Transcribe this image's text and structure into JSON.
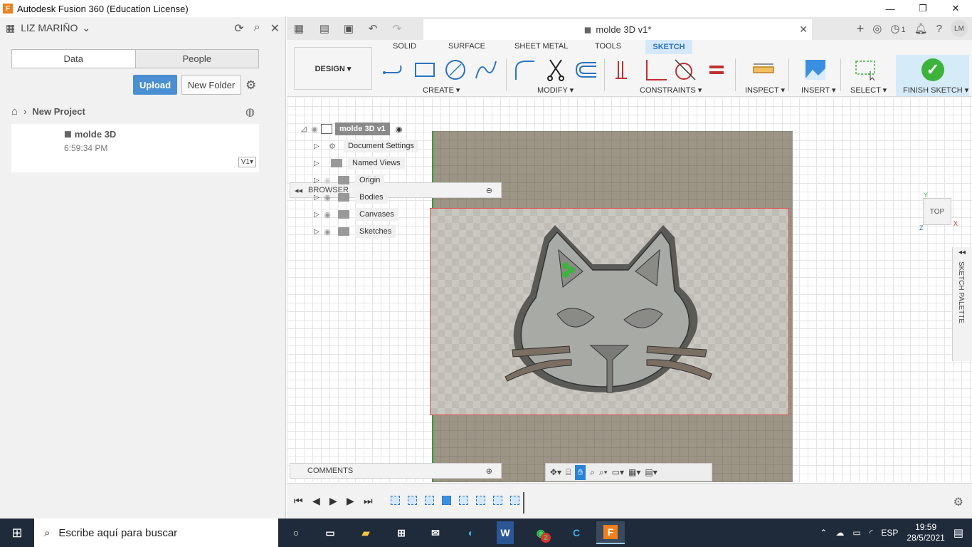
{
  "window": {
    "title": "Autodesk Fusion 360 (Education License)",
    "app_icon": "F",
    "min": "—",
    "restore": "❐",
    "close": "✕"
  },
  "left_panel": {
    "user": "LIZ MARIÑO",
    "tabs": {
      "data": "Data",
      "people": "People"
    },
    "upload_label": "Upload",
    "new_folder_label": "New Folder",
    "breadcrumb_project": "New Project",
    "file": {
      "name": "molde 3D",
      "time": "6:59:34 PM",
      "version": "V1▾"
    }
  },
  "doc_tab": {
    "title": "molde 3D v1*"
  },
  "tabbar": {
    "jobs_count": "1",
    "avatar": "LM"
  },
  "ribbon": {
    "workspace": "DESIGN ▾",
    "tabs": [
      "SOLID",
      "SURFACE",
      "SHEET METAL",
      "TOOLS",
      "SKETCH"
    ],
    "active_tab": "SKETCH",
    "groups": {
      "create": "CREATE ▾",
      "modify": "MODIFY ▾",
      "constraints": "CONSTRAINTS ▾",
      "inspect": "INSPECT ▾",
      "insert": "INSERT ▾",
      "select": "SELECT ▾",
      "finish": "FINISH SKETCH ▾"
    }
  },
  "browser": {
    "label": "BROWSER",
    "root": "molde 3D v1",
    "items": [
      "Document Settings",
      "Named Views",
      "Origin",
      "Bodies",
      "Canvases",
      "Sketches"
    ]
  },
  "viewcube": {
    "face": "TOP",
    "axis_y": "Y",
    "axis_x": "X",
    "axis_z": "Z"
  },
  "sketch_palette": {
    "label": "SKETCH PALETTE"
  },
  "comments": {
    "label": "COMMENTS"
  },
  "taskbar": {
    "search_placeholder": "Escribe aquí para buscar",
    "whatsapp_badge": "2",
    "language": "ESP",
    "time": "19:59",
    "date": "28/5/2021"
  },
  "colors": {
    "accent": "#2a74c0",
    "upload": "#4a8fd1",
    "finish_check": "#3cb43c",
    "ground": "#9c9485",
    "taskbar": "#1f2a3a"
  }
}
